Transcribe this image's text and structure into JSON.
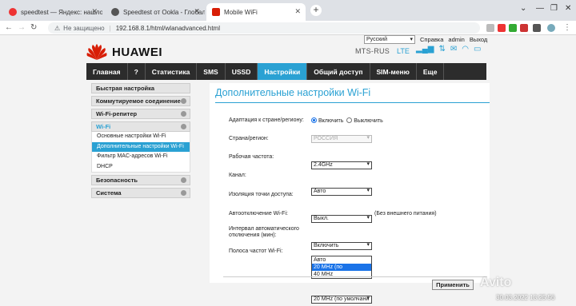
{
  "browser": {
    "tabs": [
      {
        "title": "speedtest — Яндекс: нашлось 8",
        "icon": "yandex-icon",
        "color": "#e33"
      },
      {
        "title": "Speedtest от Ookla - Глобальн",
        "icon": "speedtest-icon",
        "color": "#555"
      },
      {
        "title": "Mobile WiFi",
        "icon": "huawei-icon",
        "color": "#d81e06"
      }
    ],
    "insecure_label": "Не защищено",
    "url": "192.168.8.1/html/wlanadvanced.html"
  },
  "header": {
    "language": "Русский",
    "help": "Справка",
    "user": "admin",
    "logout": "Выход",
    "brand": "HUAWEI",
    "operator": "MTS-RUS",
    "network": "LTE"
  },
  "menu": [
    "Главная",
    "?",
    "Статистика",
    "SMS",
    "USSD",
    "Настройки",
    "Общий доступ",
    "SIM-меню",
    "Еще"
  ],
  "sidebar": {
    "quick": "Быстрая настройка",
    "dialup": "Коммутируемое соединение",
    "repeater": "Wi-Fi-репитер",
    "wifi": "Wi-Fi",
    "wifi_items": [
      "Основные настройки Wi-Fi",
      "Дополнительные настройки Wi-Fi",
      "Фильтр MAC-адресов Wi-Fi",
      "DHCP"
    ],
    "security": "Безопасность",
    "system": "Система"
  },
  "content": {
    "title": "Дополнительные настройки Wi-Fi",
    "adapt_label": "Адаптация к стране/региону:",
    "adapt_on": "Включить",
    "adapt_off": "Выключить",
    "country_label": "Страна/регион:",
    "country_value": "РОССИЯ",
    "freq_label": "Рабочая частота:",
    "freq_value": "2.4GHz",
    "channel_label": "Канал:",
    "channel_value": "Авто",
    "isolation_label": "Изоляция точки доступа:",
    "isolation_value": "Выкл.",
    "autooff_label": "Автоотключение Wi-Fi:",
    "autooff_value": "Включить",
    "autooff_note": "(Без внешнего питания)",
    "interval_label_1": "Интервал автоматического",
    "interval_label_2": "отключения (мин):",
    "interval_value": "10",
    "bandwidth_label": "Полоса частот Wi-Fi:",
    "bandwidth_value": "20 MHz (по умолчани",
    "bandwidth_options": [
      "Авто",
      "20 MHz (по умолчанию)",
      "40 MHz"
    ],
    "apply": "Применить"
  },
  "overlay": {
    "watermark": "Avito",
    "timestamp": "30.03.2022 13:25:56"
  }
}
